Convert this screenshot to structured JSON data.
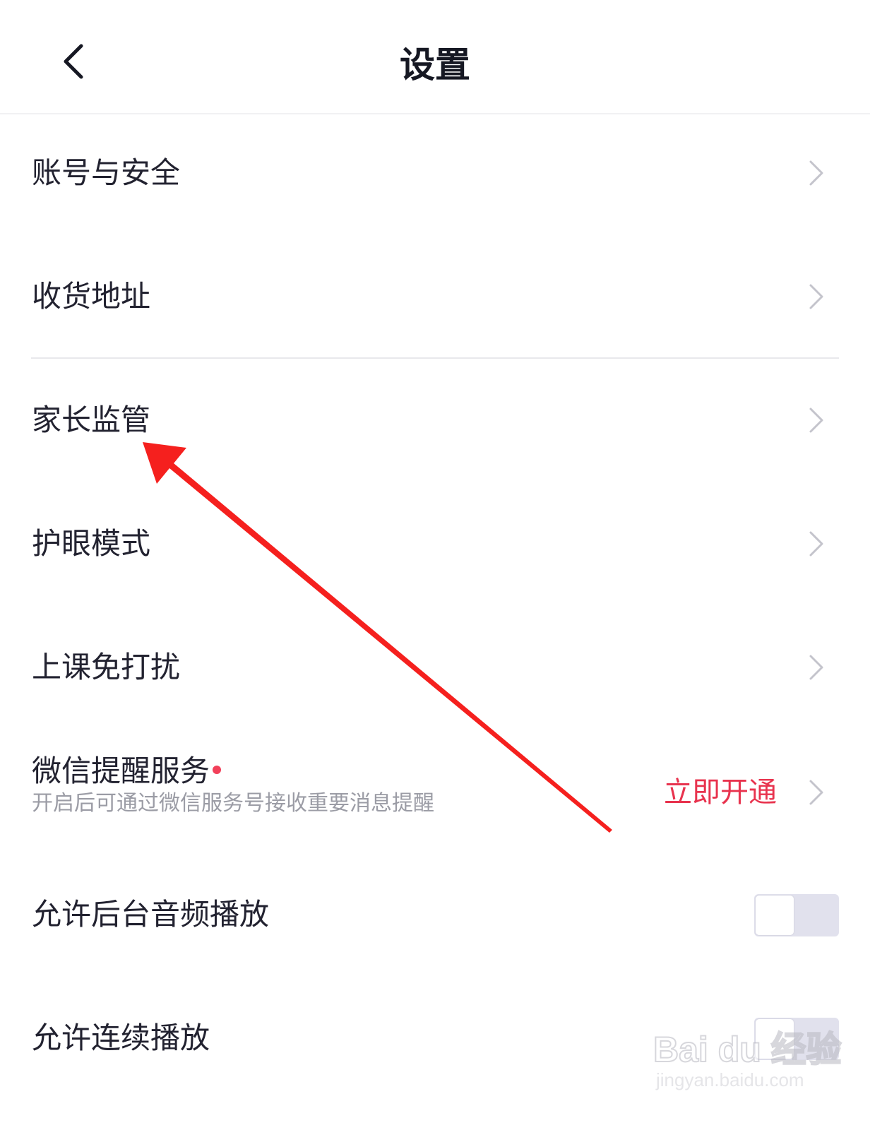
{
  "header": {
    "title": "设置"
  },
  "settings": {
    "account_security": "账号与安全",
    "shipping_address": "收货地址",
    "parental_control": "家长监管",
    "eye_protection": "护眼模式",
    "class_do_not_disturb": "上课免打扰",
    "wechat_reminder": {
      "label": "微信提醒服务",
      "description": "开启后可通过微信服务号接收重要消息提醒",
      "action": "立即开通"
    },
    "background_audio": {
      "label": "允许后台音频播放",
      "enabled": false
    },
    "continuous_play": {
      "label": "允许连续播放",
      "enabled": false
    }
  },
  "watermark": {
    "brand": "Bai du 经验",
    "url": "jingyan.baidu.com"
  },
  "colors": {
    "accent": "#e8334e",
    "annotation_arrow": "#f5201e",
    "toggle_off": "#e1e1ed"
  }
}
